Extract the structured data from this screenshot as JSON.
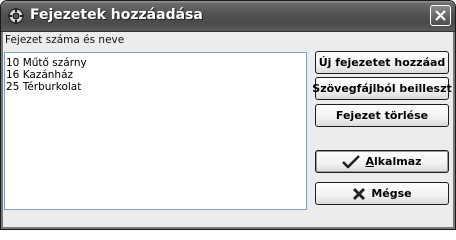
{
  "window": {
    "title": "Fejezetek hozzáadása",
    "icons": {
      "app": "app-gear-icon",
      "close": "close-icon"
    }
  },
  "list": {
    "label": "Fejezet száma és neve",
    "items": [
      "10 Műtő szárny",
      "16 Kazánház",
      "25 Térburkolat"
    ]
  },
  "buttons": {
    "add_new": "Új fejezetet hozzáad",
    "paste_from_text": "Szövegfájlból beilleszt",
    "delete": "Fejezet törlése",
    "apply_prefix": "A",
    "apply_rest": "lkalmaz",
    "cancel": "Mégse",
    "apply_icon": "checkmark-icon",
    "cancel_icon": "x-icon"
  }
}
